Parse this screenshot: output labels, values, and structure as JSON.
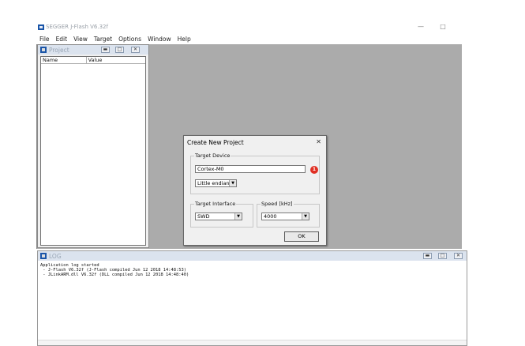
{
  "window": {
    "title": "SEGGER J-Flash V6.32f",
    "minimize_glyph": "—",
    "maximize_glyph": "□"
  },
  "menu": [
    "File",
    "Edit",
    "View",
    "Target",
    "Options",
    "Window",
    "Help"
  ],
  "project": {
    "title": "Project",
    "columns": [
      "Name",
      "Value"
    ]
  },
  "log": {
    "title": "LOG",
    "lines": [
      "Application log started",
      " - J-Flash V6.32f (J-Flash compiled Jun 12 2018 14:48:53)",
      " - JLinkARM.dll V6.32f (DLL compiled Jun 12 2018 14:48:40)"
    ]
  },
  "dialog": {
    "title": "Create New Project",
    "close_glyph": "✕",
    "target_device_label": "Target Device",
    "device_value": "Cortex-M0",
    "endian_value": "Little endian",
    "interface_label": "Target Interface",
    "interface_value": "SWD",
    "speed_label": "Speed [kHz]",
    "speed_value": "4000",
    "ok_label": "OK",
    "badge_text": "1",
    "badge_color": "#e02f23"
  }
}
